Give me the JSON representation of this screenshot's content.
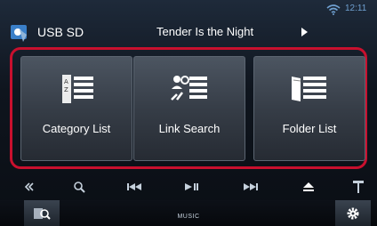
{
  "status_bar": {
    "time": "12:11",
    "wifi_icon": "wifi-icon"
  },
  "header": {
    "source_label": "USB SD",
    "track_title": "Tender Is the Night",
    "source_icon": "usb-music-icon",
    "play_icon": "play-icon"
  },
  "tiles": [
    {
      "label": "Category List",
      "icon": "category-list-icon"
    },
    {
      "label": "Link Search",
      "icon": "link-search-icon"
    },
    {
      "label": "Folder List",
      "icon": "folder-list-icon"
    }
  ],
  "controls": {
    "items": [
      "collapse-icon",
      "search-icon",
      "previous-track-icon",
      "play-pause-icon",
      "next-track-icon",
      "eject-icon",
      "antenna-icon"
    ]
  },
  "bottom_bar": {
    "label": "MUSIC",
    "left_icon": "music-search-icon",
    "right_icon": "settings-gear-icon"
  },
  "colors": {
    "highlight": "#c8102e",
    "clock": "#6fa0d0"
  }
}
